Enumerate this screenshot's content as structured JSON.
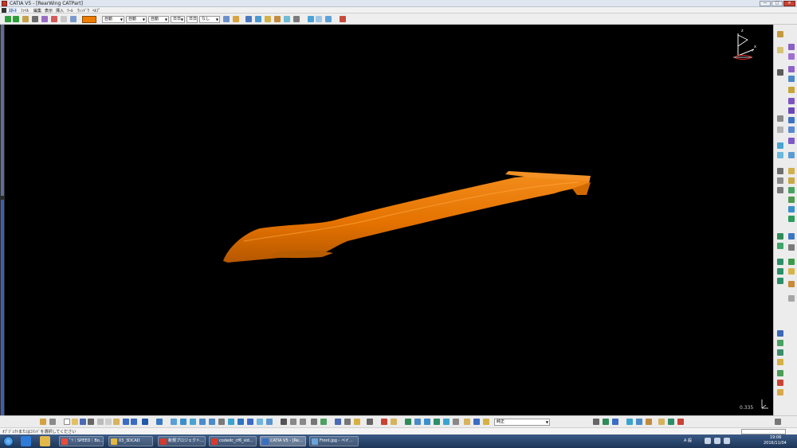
{
  "window": {
    "title": "CATIA V5 - [RearWing CATPart]",
    "buttons": {
      "minimize": "—",
      "maximize": "□",
      "close": "✕"
    }
  },
  "menu": {
    "items": [
      "ｽﾀｰﾄ",
      "ﾌｧｲﾙ",
      "編集",
      "表示",
      "挿入",
      "ﾂｰﾙ",
      "ｳｨﾝﾄﾞｳ",
      "ﾍﾙﾌﾟ"
    ]
  },
  "toolbar": {
    "color_hex": "#f07d00",
    "selects": [
      "自動",
      "自動",
      "自動",
      "なし"
    ],
    "thickness": "日日",
    "icons": [
      "move-icon",
      "move-icon",
      "pencil-icon",
      "brush-icon",
      "paint-icon",
      "eraser-icon",
      "dimension-icon",
      "sketch-icon",
      "dim-icon",
      "copy-icon",
      "grid-icon",
      "measure-icon",
      "tool-icon",
      "analysis-icon"
    ]
  },
  "viewport": {
    "part_color": "#e87400",
    "scale_value": "0.335"
  },
  "axis": {
    "z_label": "z",
    "x_label": "x",
    "y_label": "y"
  },
  "bottom_toolbar": {
    "combo_value": "純正"
  },
  "statusbar": {
    "text": "ｵﾌﾞｼﾞｪｸﾄまたはｺﾏﾝﾄﾞを選択してください"
  },
  "taskbar": {
    "buttons": [
      {
        "label": "ﾟﾂ｜SPEED｜Bo...",
        "icon_color": "#e84c3d"
      },
      {
        "label": "03_3DCAD",
        "icon_color": "#e3b842"
      },
      {
        "label": "新規プロジェクト...",
        "icon_color": "#d93a2b"
      },
      {
        "label": "codedc_cf6_sld...",
        "icon_color": "#d93a2b"
      },
      {
        "label": "CATIA V5 - [Re...",
        "icon_color": "#3a6fc4"
      },
      {
        "label": "Front.jpg - ペイ...",
        "icon_color": "#6aa3d8"
      }
    ],
    "tray_lang": "A 般",
    "clock_time": "19:06",
    "clock_date": "2016/11/04"
  }
}
